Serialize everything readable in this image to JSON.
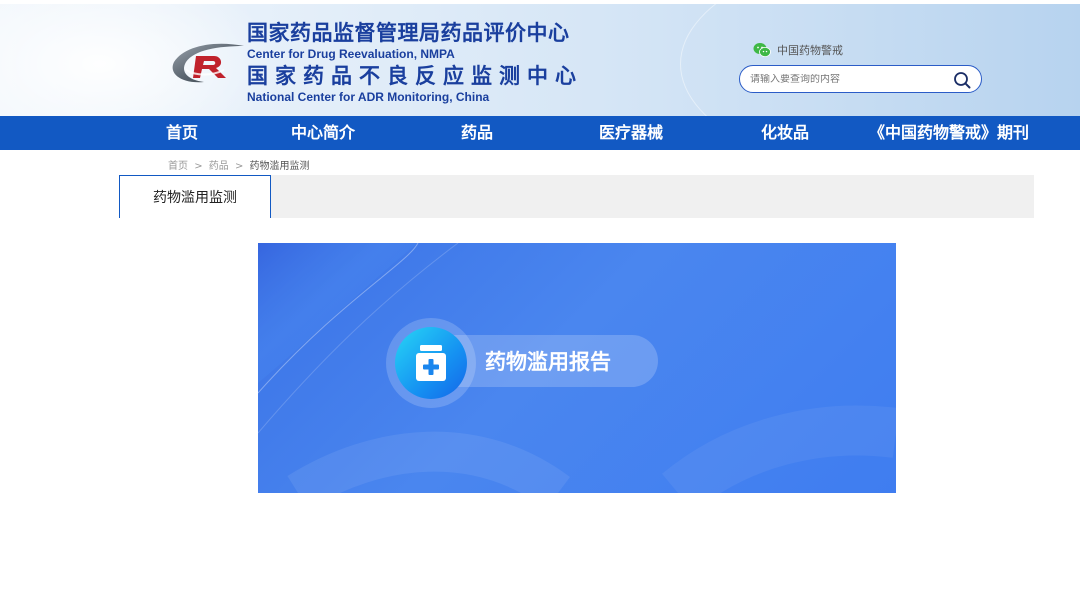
{
  "header": {
    "title_cn_1": "国家药品监督管理局药品评价中心",
    "title_en_1": "Center for Drug Reevaluation, NMPA",
    "title_cn_2": "国家药品不良反应监测中心",
    "title_en_2": "National Center for ADR Monitoring, China",
    "logo_icon": "cdr-logo-icon",
    "wechat_label": "中国药物警戒",
    "wechat_icon": "wechat-icon",
    "search_placeholder": "请输入要查询的内容",
    "search_icon": "search-icon"
  },
  "nav": {
    "items": [
      {
        "label": "首页"
      },
      {
        "label": "中心简介"
      },
      {
        "label": "药品"
      },
      {
        "label": "医疗器械"
      },
      {
        "label": "化妆品"
      },
      {
        "label": "《中国药物警戒》期刊"
      }
    ]
  },
  "breadcrumb": {
    "home": "首页",
    "sep1": ">",
    "category": "药品",
    "sep2": ">",
    "current": "药物滥用监测"
  },
  "tabs": {
    "active_label": "药物滥用监测"
  },
  "banner": {
    "label": "药物滥用报告",
    "icon": "medicine-box-icon"
  },
  "colors": {
    "nav_bg": "#1259c3",
    "title": "#1a3f9e",
    "banner_bg": "#4a86ef"
  }
}
